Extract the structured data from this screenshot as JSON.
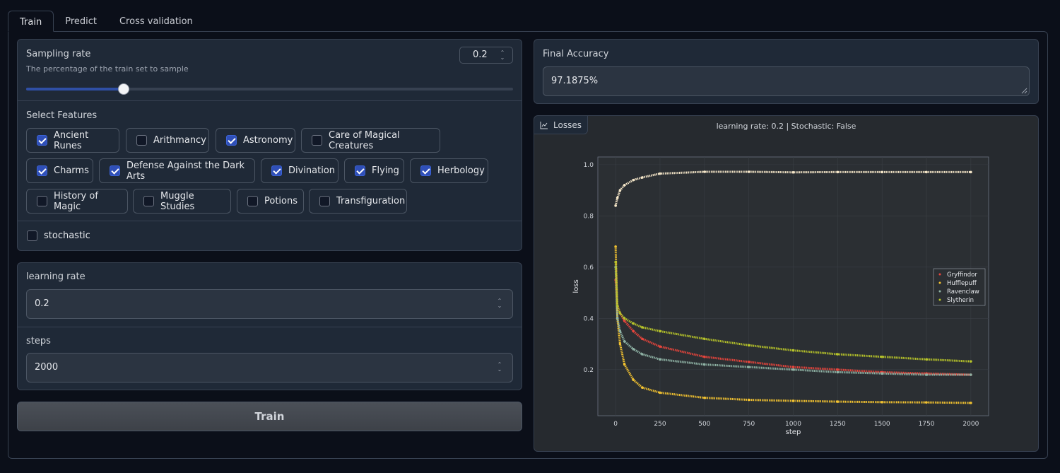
{
  "tabs": [
    "Train",
    "Predict",
    "Cross validation"
  ],
  "sampling": {
    "label": "Sampling rate",
    "info": "The percentage of the train set to sample",
    "value": "0.2",
    "slider_fraction": 0.2
  },
  "features": {
    "label": "Select Features",
    "options": [
      {
        "label": "Ancient Runes",
        "checked": true
      },
      {
        "label": "Arithmancy",
        "checked": false
      },
      {
        "label": "Astronomy",
        "checked": true
      },
      {
        "label": "Care of Magical Creatures",
        "checked": false
      },
      {
        "label": "Charms",
        "checked": true
      },
      {
        "label": "Defense Against the Dark Arts",
        "checked": true
      },
      {
        "label": "Divination",
        "checked": true
      },
      {
        "label": "Flying",
        "checked": true
      },
      {
        "label": "Herbology",
        "checked": true
      },
      {
        "label": "History of Magic",
        "checked": false
      },
      {
        "label": "Muggle Studies",
        "checked": false
      },
      {
        "label": "Potions",
        "checked": false
      },
      {
        "label": "Transfiguration",
        "checked": false
      }
    ]
  },
  "stochastic": {
    "label": "stochastic",
    "checked": false
  },
  "learning_rate": {
    "label": "learning rate",
    "value": "0.2"
  },
  "steps": {
    "label": "steps",
    "value": "2000"
  },
  "train_button": "Train",
  "final_accuracy": {
    "label": "Final Accuracy",
    "value": "97.1875%"
  },
  "plot": {
    "label": "Losses",
    "icon": "chart-icon"
  },
  "colors": {
    "accent": "#2f4fb8",
    "background": "#0b0f19",
    "panel": "#1f2937"
  },
  "chart_data": {
    "type": "scatter",
    "title": "learning rate: 0.2 | Stochastic: False",
    "xlabel": "step",
    "ylabel": "loss",
    "xlim": [
      -100,
      2100
    ],
    "ylim": [
      0.02,
      1.03
    ],
    "xticks": [
      0,
      250,
      500,
      750,
      1000,
      1250,
      1500,
      1750,
      2000
    ],
    "yticks": [
      0.2,
      0.4,
      0.6,
      0.8,
      1.0
    ],
    "grid": true,
    "legend": "right",
    "x": [
      0,
      10,
      25,
      50,
      100,
      150,
      250,
      500,
      750,
      1000,
      1250,
      1500,
      1750,
      2000
    ],
    "series": [
      {
        "name": "Gryffindor",
        "color": "#e8453c",
        "values": [
          0.55,
          0.45,
          0.42,
          0.39,
          0.35,
          0.32,
          0.29,
          0.25,
          0.23,
          0.21,
          0.2,
          0.19,
          0.185,
          0.18
        ]
      },
      {
        "name": "Hufflepuff",
        "color": "#f2c230",
        "values": [
          0.68,
          0.4,
          0.3,
          0.22,
          0.16,
          0.13,
          0.11,
          0.09,
          0.082,
          0.078,
          0.075,
          0.073,
          0.072,
          0.07
        ]
      },
      {
        "name": "Ravenclaw",
        "color": "#8fb3a5",
        "values": [
          0.6,
          0.4,
          0.35,
          0.31,
          0.28,
          0.26,
          0.24,
          0.22,
          0.21,
          0.2,
          0.19,
          0.185,
          0.18,
          0.18
        ]
      },
      {
        "name": "Slytherin",
        "color": "#b7c42a",
        "values": [
          0.62,
          0.45,
          0.42,
          0.4,
          0.38,
          0.365,
          0.35,
          0.32,
          0.295,
          0.275,
          0.26,
          0.25,
          0.24,
          0.232
        ]
      }
    ],
    "accuracy_series": {
      "color": "#f5e6c8",
      "values": [
        0.84,
        0.87,
        0.9,
        0.92,
        0.94,
        0.95,
        0.965,
        0.972,
        0.972,
        0.97,
        0.971,
        0.971,
        0.971,
        0.971
      ]
    }
  }
}
